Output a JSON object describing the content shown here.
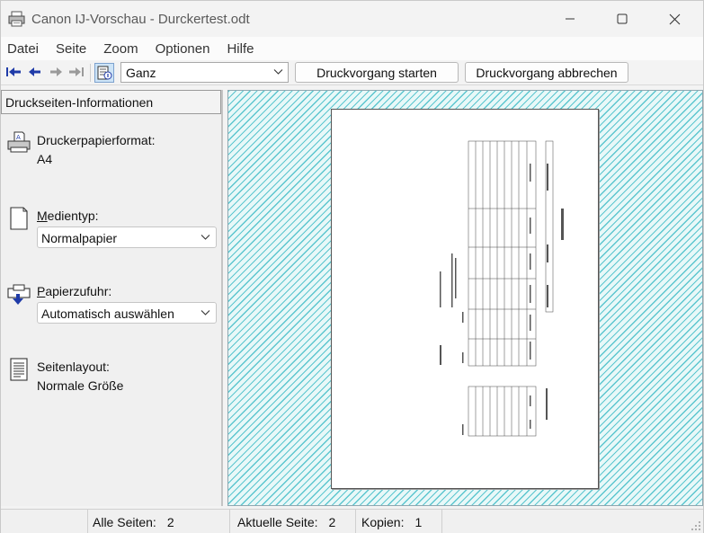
{
  "window": {
    "title": "Canon IJ-Vorschau - Durckertest.odt"
  },
  "menu": [
    "Datei",
    "Seite",
    "Zoom",
    "Optionen",
    "Hilfe"
  ],
  "toolbar": {
    "zoom_value": "Ganz",
    "start_label": "Druckvorgang starten",
    "abort_label": "Druckvorgang abbrechen"
  },
  "panel": {
    "header": "Druckseiten-Informationen",
    "paper_format_label": "Druckerpapierformat:",
    "paper_format_value": "A4",
    "media_type_label_accel": "M",
    "media_type_label_rest": "edientyp:",
    "media_type_value": "Normalpapier",
    "paper_source_label_accel": "P",
    "paper_source_label_rest": "apierzufuhr:",
    "paper_source_value": "Automatisch auswählen",
    "page_layout_label": "Seitenlayout:",
    "page_layout_value": "Normale Größe"
  },
  "status": {
    "all_pages_label": "Alle Seiten:",
    "all_pages_value": "2",
    "current_page_label": "Aktuelle Seite:",
    "current_page_value": "2",
    "copies_label": "Kopien:",
    "copies_value": "1"
  },
  "colors": {
    "preview_hatch": "#5cc6cf",
    "toggle_active": "#cde4f7"
  }
}
